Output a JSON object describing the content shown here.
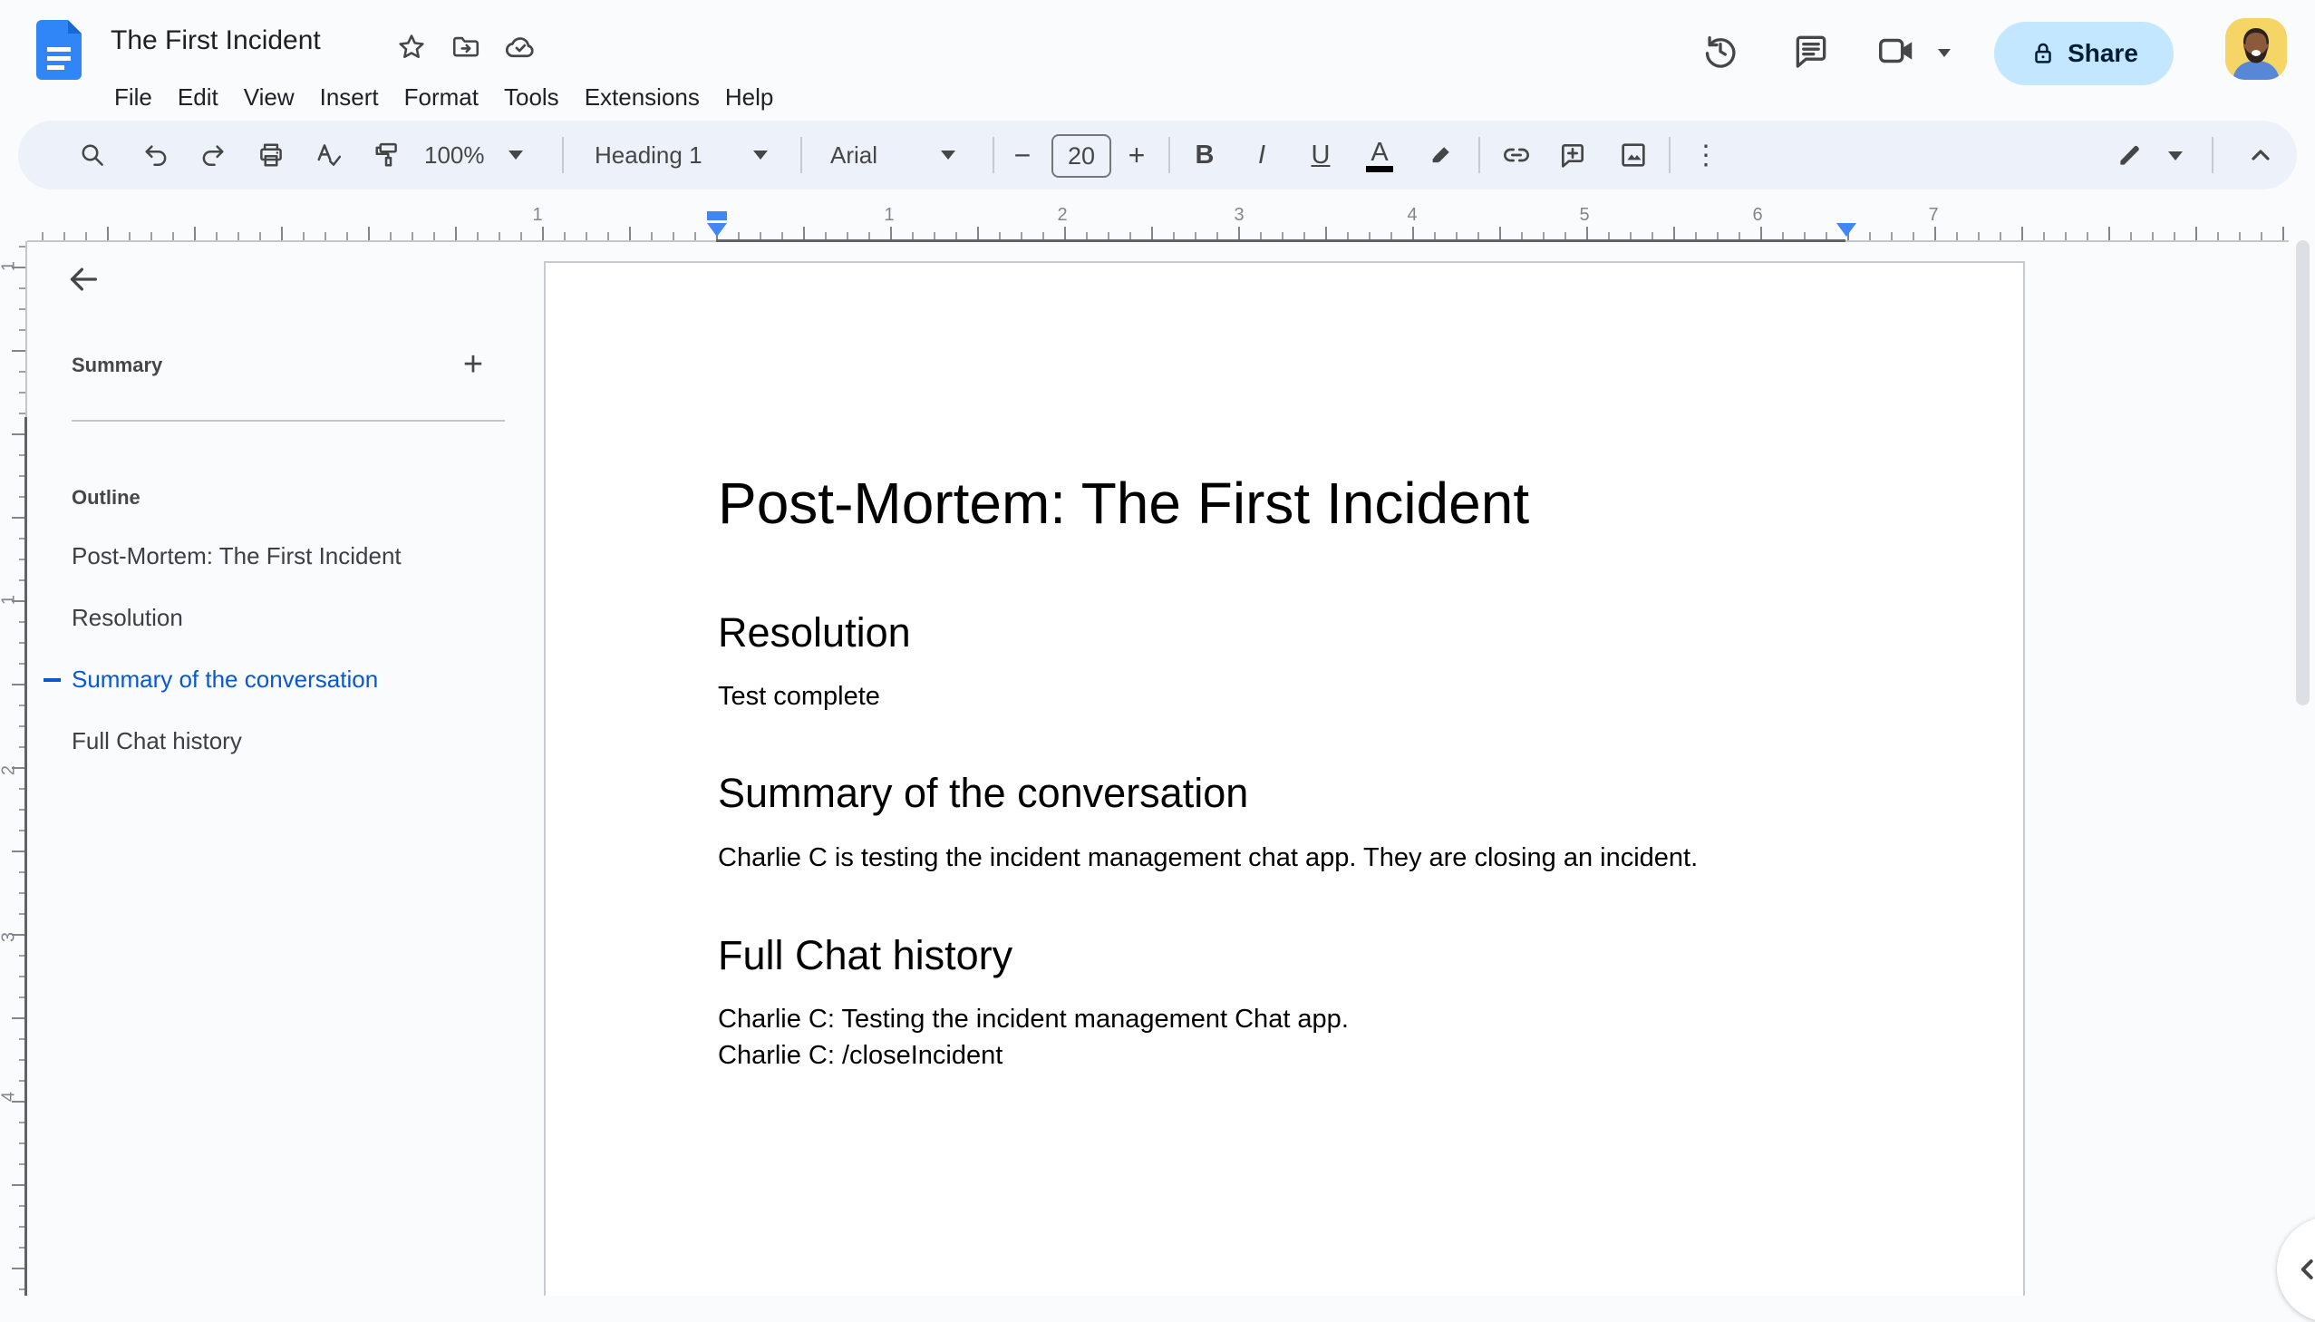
{
  "header": {
    "title": "The First Incident",
    "menu": [
      "File",
      "Edit",
      "View",
      "Insert",
      "Format",
      "Tools",
      "Extensions",
      "Help"
    ],
    "share_label": "Share"
  },
  "toolbar": {
    "zoom_value": "100%",
    "style_value": "Heading 1",
    "font_value": "Arial",
    "font_size_value": "20",
    "minus_label": "−",
    "plus_label": "+",
    "bold_label": "B",
    "italic_label": "I",
    "underline_label": "U",
    "text_color_label": "A",
    "more_label": "⋮"
  },
  "ruler": {
    "h_numbers": [
      "1",
      "1",
      "2",
      "3",
      "4",
      "5",
      "6",
      "7"
    ],
    "v_numbers": [
      "1",
      "1",
      "2",
      "3",
      "4"
    ]
  },
  "sidebar": {
    "summary_label": "Summary",
    "add_summary_label": "+",
    "outline_label": "Outline",
    "items": [
      {
        "label": "Post-Mortem: The First Incident"
      },
      {
        "label": "Resolution"
      },
      {
        "label": "Summary of the conversation"
      },
      {
        "label": "Full Chat history"
      }
    ],
    "active_item_index": 2
  },
  "document": {
    "h1": "Post-Mortem: The First Incident",
    "sections": [
      {
        "heading": "Resolution",
        "body": [
          "Test complete"
        ]
      },
      {
        "heading": "Summary of the conversation",
        "body": [
          "Charlie C is testing the incident management chat app. They are closing an incident."
        ]
      },
      {
        "heading": "Full Chat history",
        "body": [
          "Charlie C: Testing the incident management Chat app.",
          "Charlie C: /closeIncident"
        ]
      }
    ]
  },
  "icons": {
    "docs-logo": "blue document with white text lines",
    "star": "outline star",
    "move-folder": "folder with right arrow",
    "cloud-saved": "cloud with check",
    "history": "clock with counterclockwise arrow",
    "comments": "speech bubble with lines",
    "meet-video": "video camera with dropdown",
    "lock": "padlock",
    "search": "magnifier",
    "undo": "curved left arrow",
    "redo": "curved right arrow",
    "print": "printer",
    "spellcheck": "A with checkmark",
    "paint-format": "paint roller",
    "link": "chain link",
    "add-comment": "bubble with plus",
    "insert-image": "picture with mountain",
    "edit-mode": "pencil",
    "hide-menus": "chevron up",
    "back": "left arrow",
    "show-panel": "chevron left"
  },
  "colors": {
    "toolbar_bg": "#edf2fa",
    "share_bg": "#c2e7ff",
    "accent_blue": "#0b57d0",
    "marker_blue": "#4285f4",
    "canvas_bg": "#f9fbfd",
    "icon_gray": "#444746"
  }
}
